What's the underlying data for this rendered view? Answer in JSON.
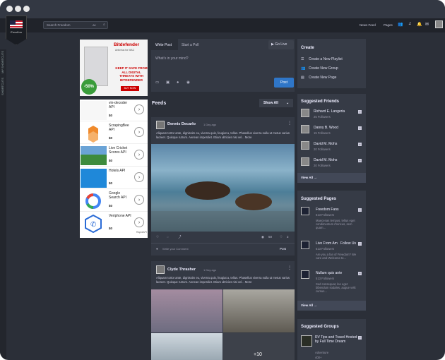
{
  "app": {
    "brand": "Freedom"
  },
  "header": {
    "search_placeholder": "Search Freedom",
    "search_scope": "All",
    "nav": [
      "News Feed",
      "Pages"
    ]
  },
  "sidebar_tabs": [
    "SHORTCUTS",
    "MY SHORTCUTS"
  ],
  "ad_bitdefender": {
    "brand": "Bitdefender",
    "subtitle": "Antivirus for MAC",
    "headline": "KEEP IT SAFE FROM ALL DIGITAL THREATS WITH BITDEFENDER",
    "button": "BUY NOW",
    "discount": "-50%"
  },
  "ad_apis": {
    "items": [
      {
        "name": "vin-decoder API",
        "price": "$0"
      },
      {
        "name": "ScrapingBee API",
        "price": "$0"
      },
      {
        "name": "Live Cricket Scores API",
        "price": "$0"
      },
      {
        "name": "Hotels API",
        "price": "$0"
      },
      {
        "name": "Google Search API",
        "price": "$0"
      },
      {
        "name": "Veriphone API",
        "price": "$0"
      }
    ],
    "footer": "RapidAPI"
  },
  "composer": {
    "tabs": [
      "Write Post",
      "Start a Poll"
    ],
    "go_live": "Go Live",
    "placeholder": "What's in your mind?",
    "post_button": "Post"
  },
  "feed": {
    "title": "Feeds",
    "filter": "Show All",
    "posts": [
      {
        "author": "Dennis Decarlo",
        "time": "1 Day ago",
        "text": "Aliquam tortor ante, dignissim eu, viverra quis, feugiat a, tellus. Phasellus viverra nulla ut metus varius laoreet. Quisque rutrum. Aenean imperdiet. Etiam ultricies nisi vel... More",
        "views": "50",
        "likes": "2",
        "comment_placeholder": "Write your Comment",
        "comment_post": "Post"
      },
      {
        "author": "Clyde Thrasher",
        "time": "1 Day ago",
        "text": "Aliquam tortor ante, dignissim eu, viverra quis, feugiat a, tellus. Phasellus viverra nulla ut metus varius laoreet. Quisque rutrum. Aenean imperdiet. Etiam ultricies nisi vel... More",
        "more_count": "+10"
      }
    ]
  },
  "create": {
    "title": "Create",
    "items": [
      "Create a New Playlist",
      "Create New Group",
      "Create New Page"
    ]
  },
  "suggested_friends": {
    "title": "Suggested Friends",
    "items": [
      {
        "name": "Richard E. Langeria",
        "followers": "25 Followers"
      },
      {
        "name": "Danny B. Wood",
        "followers": "15 Followers"
      },
      {
        "name": "David M. Mohs",
        "followers": "20 Followers"
      },
      {
        "name": "David M. Mohs",
        "followers": "20 Followers"
      }
    ],
    "view_all": "View All"
  },
  "suggested_pages": {
    "title": "Suggested Pages",
    "items": [
      {
        "name": "Freedom Fans",
        "followers": "513 Followers",
        "desc": "Maecenas tempus, tellus eget condimentum rhoncus, sem quam..."
      },
      {
        "name": "Live From Am",
        "action": "Follow Us",
        "followers": "513 Followers",
        "desc": "Are you a fan of Freedom? We care and Welcome to..."
      },
      {
        "name": "Nullam quis ante",
        "followers": "513 Followers",
        "desc": "Sed consequat, leo eget bibendum sodales, augue velit cursus..."
      }
    ],
    "view_all": "View All"
  },
  "suggested_groups": {
    "title": "Suggested Groups",
    "items": [
      {
        "name": "RV Tips and Travel Hosted by Full Time Dream",
        "category": "Adventure",
        "count": "400+"
      }
    ]
  },
  "colors": {
    "accent": "#2f76c8",
    "background": "#2b2f38",
    "card": "#343944"
  }
}
